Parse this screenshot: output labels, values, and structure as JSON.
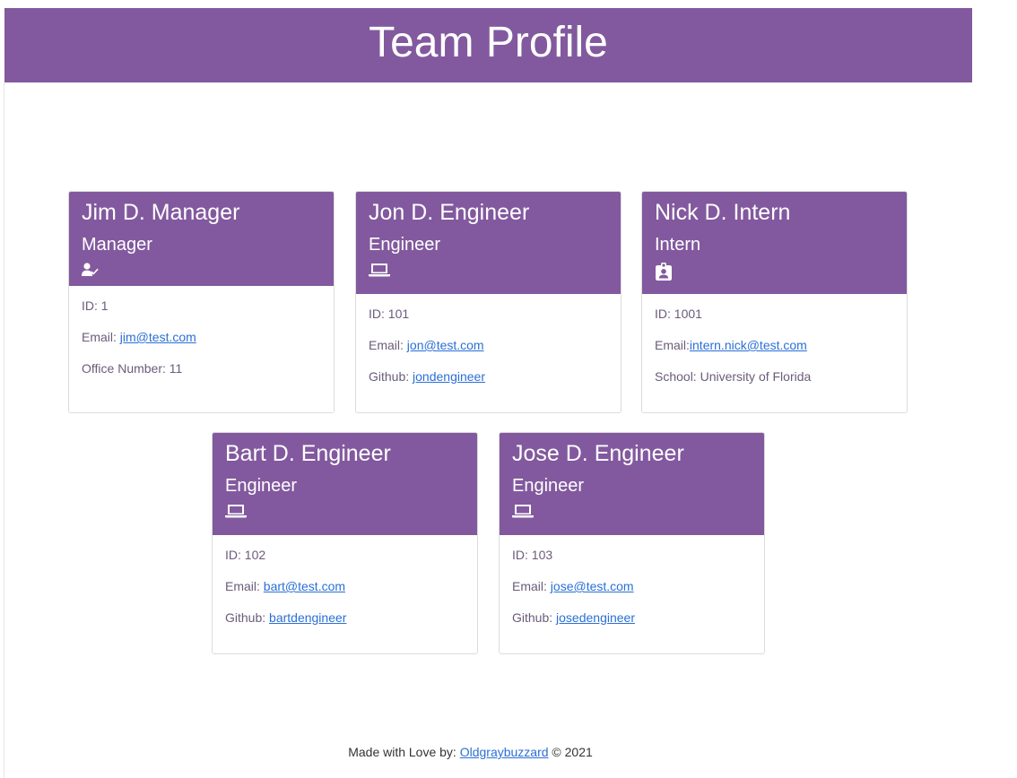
{
  "header": {
    "title": "Team Profile"
  },
  "cards": [
    {
      "name": "Jim D. Manager",
      "role": "Manager",
      "icon": "user-check-icon",
      "id_label": "ID: ",
      "id": "1",
      "email_label": "Email: ",
      "email": "jim@test.com",
      "extra_label": "Office Number: ",
      "extra": "11"
    },
    {
      "name": "Jon D. Engineer",
      "role": "Engineer",
      "icon": "laptop-icon",
      "id_label": "ID: ",
      "id": "101",
      "email_label": "Email: ",
      "email": "jon@test.com",
      "extra_label": "Github: ",
      "extra": "jondengineer"
    },
    {
      "name": "Nick D. Intern",
      "role": "Intern",
      "icon": "id-badge-icon",
      "id_label": "ID: ",
      "id": "1001",
      "email_label": "Email:",
      "email": "intern.nick@test.com",
      "extra_label": "School: ",
      "extra": "University of Florida"
    },
    {
      "name": "Bart D. Engineer",
      "role": "Engineer",
      "icon": "laptop-icon",
      "id_label": "ID: ",
      "id": "102",
      "email_label": "Email: ",
      "email": "bart@test.com",
      "extra_label": "Github: ",
      "extra": "bartdengineer"
    },
    {
      "name": "Jose D. Engineer",
      "role": "Engineer",
      "icon": "laptop-icon",
      "id_label": "ID: ",
      "id": "103",
      "email_label": "Email: ",
      "email": "jose@test.com",
      "extra_label": "Github: ",
      "extra": "josedengineer"
    }
  ],
  "footer": {
    "prefix": "Made with Love by: ",
    "author": "Oldgraybuzzard",
    "suffix": " © 2021"
  },
  "colors": {
    "accent": "#82599e",
    "link": "#2a6fd6"
  }
}
